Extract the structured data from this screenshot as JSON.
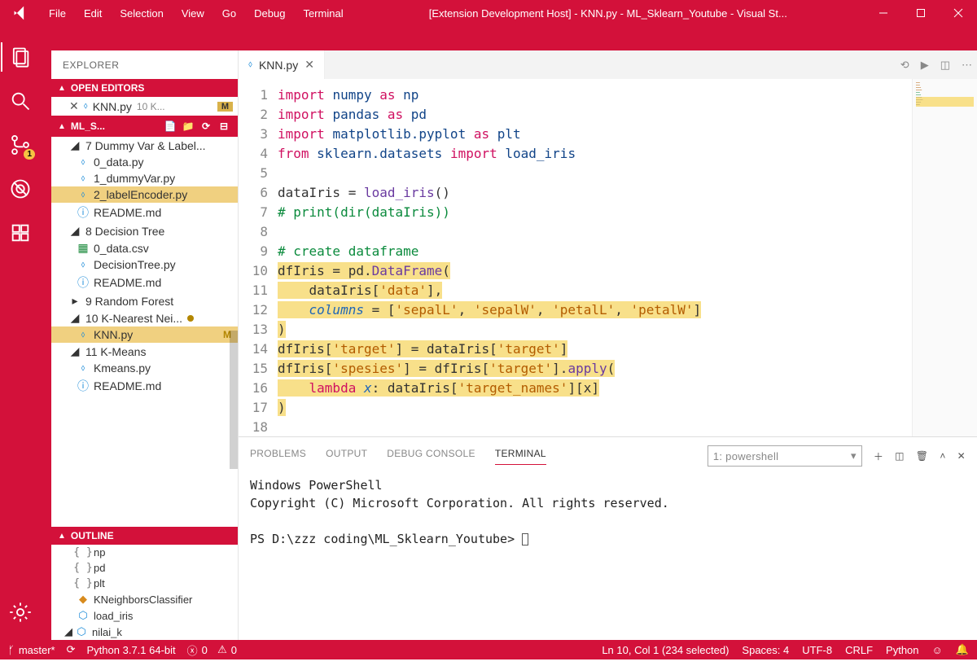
{
  "titlebar": {
    "menus": [
      "File",
      "Edit",
      "Selection",
      "View",
      "Go",
      "Debug",
      "Terminal"
    ],
    "title": "[Extension Development Host] - KNN.py - ML_Sklearn_Youtube - Visual St..."
  },
  "activity_badge": "1",
  "sidebar": {
    "header": "EXPLORER",
    "open_editors_title": "OPEN EDITORS",
    "open_editor": {
      "name": "KNN.py",
      "desc": "10 K...",
      "badge": "M"
    },
    "workspace_title": "ML_S...",
    "tree": [
      {
        "type": "folder",
        "label": "7 Dummy Var & Label...",
        "open": true
      },
      {
        "type": "py",
        "label": "0_data.py"
      },
      {
        "type": "py",
        "label": "1_dummyVar.py"
      },
      {
        "type": "py",
        "label": "2_labelEncoder.py",
        "sel": true
      },
      {
        "type": "info",
        "label": "README.md"
      },
      {
        "type": "folder",
        "label": "8 Decision Tree",
        "open": true
      },
      {
        "type": "csv",
        "label": "0_data.csv"
      },
      {
        "type": "py",
        "label": "DecisionTree.py"
      },
      {
        "type": "info",
        "label": "README.md"
      },
      {
        "type": "folder",
        "label": "9 Random Forest",
        "open": false
      },
      {
        "type": "folder",
        "label": "10 K-Nearest Nei...",
        "open": true,
        "mod": true
      },
      {
        "type": "py",
        "label": "KNN.py",
        "hl": true,
        "m": "M"
      },
      {
        "type": "folder",
        "label": "11 K-Means",
        "open": true
      },
      {
        "type": "py",
        "label": "Kmeans.py"
      },
      {
        "type": "info",
        "label": "README.md"
      }
    ],
    "outline_title": "OUTLINE",
    "outline": [
      {
        "icon": "curly",
        "label": "np"
      },
      {
        "icon": "curly",
        "label": "pd"
      },
      {
        "icon": "curly",
        "label": "plt"
      },
      {
        "icon": "class",
        "label": "KNeighborsClassifier"
      },
      {
        "icon": "var",
        "label": "load_iris"
      },
      {
        "icon": "var",
        "label": "nilai_k",
        "chev": true
      }
    ]
  },
  "editor": {
    "tab_name": "KNN.py",
    "line_numbers": [
      1,
      2,
      3,
      4,
      5,
      6,
      7,
      8,
      9,
      10,
      11,
      12,
      13,
      14,
      15,
      16,
      17,
      18
    ]
  },
  "panel": {
    "tabs": [
      "PROBLEMS",
      "OUTPUT",
      "DEBUG CONSOLE",
      "TERMINAL"
    ],
    "active": "TERMINAL",
    "term_select": "1: powershell",
    "lines": [
      "Windows PowerShell",
      "Copyright (C) Microsoft Corporation. All rights reserved.",
      "",
      "PS D:\\zzz coding\\ML_Sklearn_Youtube> "
    ]
  },
  "statusbar": {
    "branch": "master*",
    "python": "Python 3.7.1 64-bit",
    "errors": "0",
    "warnings": "0",
    "position": "Ln 10, Col 1 (234 selected)",
    "spaces": "Spaces: 4",
    "encoding": "UTF-8",
    "eol": "CRLF",
    "lang": "Python"
  }
}
